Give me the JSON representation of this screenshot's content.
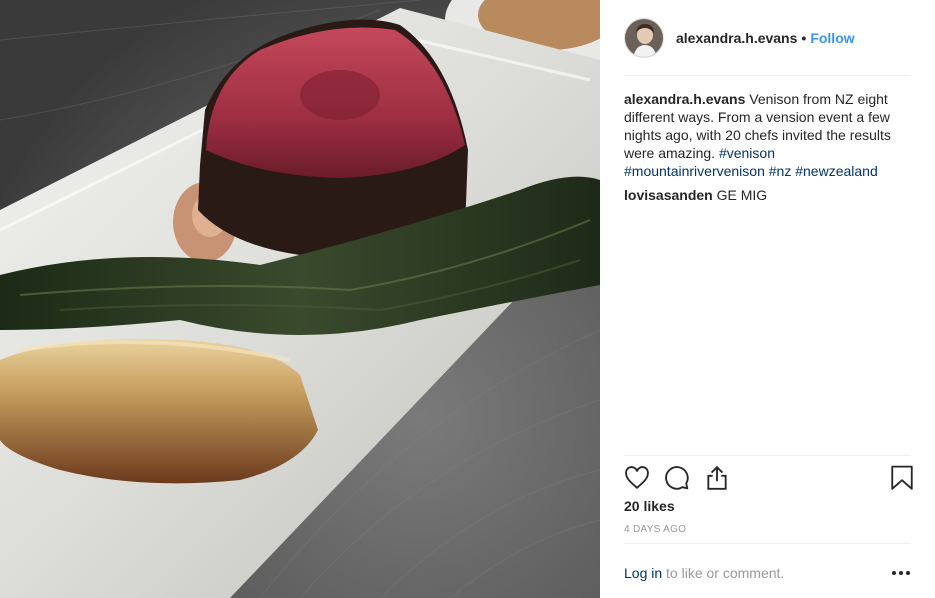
{
  "header": {
    "username": "alexandra.h.evans",
    "separator": "•",
    "follow_label": "Follow"
  },
  "caption": {
    "username": "alexandra.h.evans",
    "text": "Venison from NZ eight different ways. From a vension event a few nights ago, with 20 chefs invited the results were amazing.",
    "hashtags": [
      "#venison",
      "#mountainrivervenison",
      "#nz",
      "#newzealand"
    ]
  },
  "comments": [
    {
      "username": "lovisasanden",
      "text": "GE MIG"
    }
  ],
  "actions": {
    "like_icon": "heart-icon",
    "comment_icon": "comment-icon",
    "share_icon": "share-icon",
    "save_icon": "bookmark-icon"
  },
  "likes": "20 likes",
  "timestamp": "4 DAYS AGO",
  "footer": {
    "login_label": "Log in",
    "login_suffix": " to like or comment.",
    "more_icon": "more-options-icon"
  },
  "colors": {
    "link_blue": "#3897f0",
    "hashtag": "#003569",
    "muted": "#999999",
    "divider": "#efefef"
  }
}
